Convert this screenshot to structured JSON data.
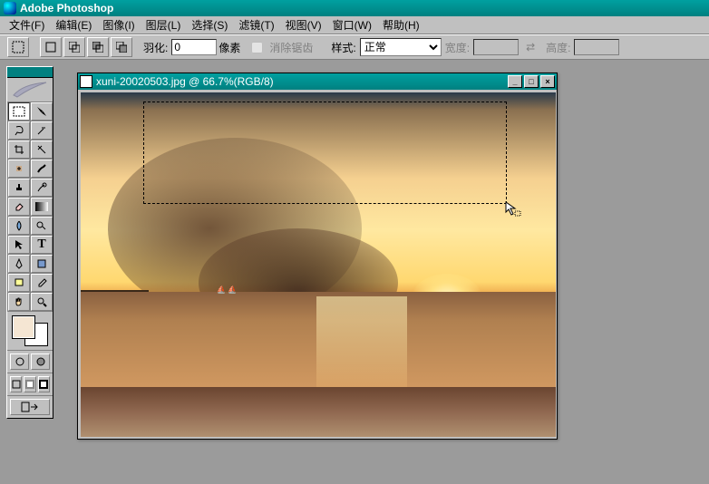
{
  "app_title": "Adobe Photoshop",
  "menus": [
    "文件(F)",
    "编辑(E)",
    "图像(I)",
    "图层(L)",
    "选择(S)",
    "滤镜(T)",
    "视图(V)",
    "窗口(W)",
    "帮助(H)"
  ],
  "optionbar": {
    "feather_label": "羽化:",
    "feather_value": "0",
    "feather_unit": "像素",
    "antialias_label": "消除锯齿",
    "style_label": "样式:",
    "style_value": "正常",
    "width_label": "宽度:",
    "height_label": "高度:"
  },
  "document": {
    "title": "xuni-20020503.jpg @ 66.7%(RGB/8)"
  },
  "tools": [
    "marquee",
    "move",
    "lasso",
    "wand",
    "crop",
    "slice",
    "healing",
    "brush",
    "stamp",
    "history",
    "eraser",
    "gradient",
    "blur",
    "dodge",
    "path",
    "type",
    "pen",
    "shape",
    "notes",
    "eyedrop",
    "hand",
    "zoom"
  ],
  "colors": {
    "fg": "#f5e6d3",
    "bg": "#ffffff"
  }
}
